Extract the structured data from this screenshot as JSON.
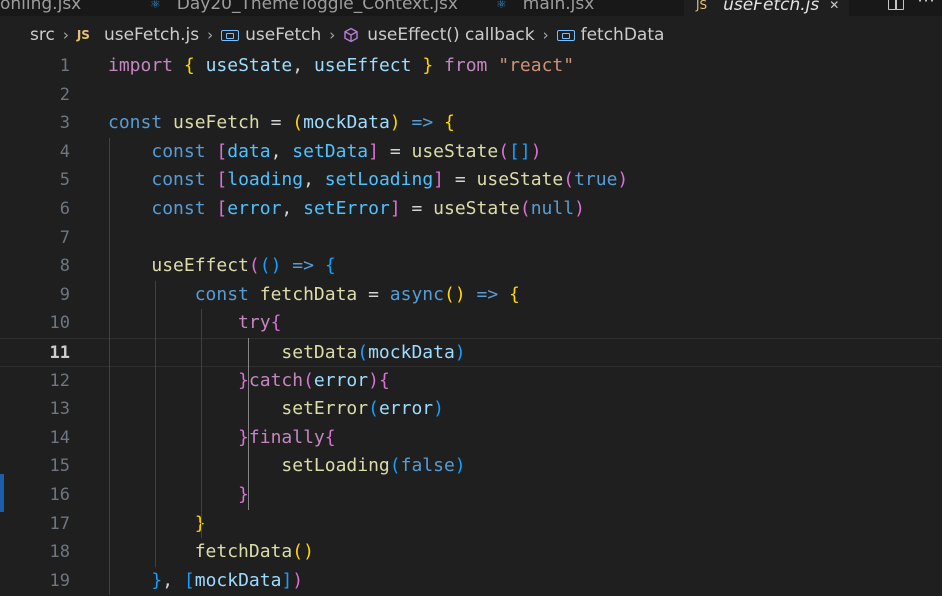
{
  "tabs": [
    {
      "label": "onling.jsx",
      "icon": "react-icon",
      "active": false
    },
    {
      "label": "Day20_ThemeToggle_Context.jsx",
      "icon": "react-icon",
      "active": false
    },
    {
      "label": "main.jsx",
      "icon": "react-icon",
      "active": false
    },
    {
      "label": "useFetch.js",
      "icon": "javascript-icon",
      "icon_text": "JS",
      "active": true,
      "close": "✕"
    }
  ],
  "breadcrumb": {
    "folder": "src",
    "file_icon_text": "JS",
    "file": "useFetch.js",
    "symbol1": "useFetch",
    "symbol2": "useEffect() callback",
    "symbol3": "fetchData",
    "separator": "›"
  },
  "editor": {
    "current_line": "11",
    "line_numbers": [
      "1",
      "2",
      "3",
      "4",
      "5",
      "6",
      "7",
      "8",
      "9",
      "10",
      "11",
      "12",
      "13",
      "14",
      "15",
      "16",
      "17",
      "18",
      "19"
    ],
    "lines": [
      [
        {
          "t": "import",
          "c": "k"
        },
        {
          "t": " ",
          "c": "p"
        },
        {
          "t": "{",
          "c": "b1"
        },
        {
          "t": " ",
          "c": "p"
        },
        {
          "t": "useState",
          "c": "v"
        },
        {
          "t": ", ",
          "c": "p"
        },
        {
          "t": "useEffect",
          "c": "v"
        },
        {
          "t": " ",
          "c": "p"
        },
        {
          "t": "}",
          "c": "b1"
        },
        {
          "t": " ",
          "c": "p"
        },
        {
          "t": "from",
          "c": "k"
        },
        {
          "t": " ",
          "c": "p"
        },
        {
          "t": "\"react\"",
          "c": "s"
        }
      ],
      [],
      [
        {
          "t": "const",
          "c": "st"
        },
        {
          "t": " ",
          "c": "p"
        },
        {
          "t": "useFetch",
          "c": "f"
        },
        {
          "t": " = ",
          "c": "p"
        },
        {
          "t": "(",
          "c": "b1"
        },
        {
          "t": "mockData",
          "c": "v"
        },
        {
          "t": ")",
          "c": "b1"
        },
        {
          "t": " ",
          "c": "p"
        },
        {
          "t": "=>",
          "c": "st"
        },
        {
          "t": " ",
          "c": "p"
        },
        {
          "t": "{",
          "c": "b1"
        }
      ],
      [
        {
          "t": "    ",
          "c": "p"
        },
        {
          "t": "const",
          "c": "st"
        },
        {
          "t": " ",
          "c": "p"
        },
        {
          "t": "[",
          "c": "b2"
        },
        {
          "t": "data",
          "c": "vc"
        },
        {
          "t": ", ",
          "c": "p"
        },
        {
          "t": "setData",
          "c": "vc"
        },
        {
          "t": "]",
          "c": "b2"
        },
        {
          "t": " = ",
          "c": "p"
        },
        {
          "t": "useState",
          "c": "f"
        },
        {
          "t": "(",
          "c": "b2"
        },
        {
          "t": "[]",
          "c": "b3"
        },
        {
          "t": ")",
          "c": "b2"
        }
      ],
      [
        {
          "t": "    ",
          "c": "p"
        },
        {
          "t": "const",
          "c": "st"
        },
        {
          "t": " ",
          "c": "p"
        },
        {
          "t": "[",
          "c": "b2"
        },
        {
          "t": "loading",
          "c": "vc"
        },
        {
          "t": ", ",
          "c": "p"
        },
        {
          "t": "setLoading",
          "c": "vc"
        },
        {
          "t": "]",
          "c": "b2"
        },
        {
          "t": " = ",
          "c": "p"
        },
        {
          "t": "useState",
          "c": "f"
        },
        {
          "t": "(",
          "c": "b2"
        },
        {
          "t": "true",
          "c": "st"
        },
        {
          "t": ")",
          "c": "b2"
        }
      ],
      [
        {
          "t": "    ",
          "c": "p"
        },
        {
          "t": "const",
          "c": "st"
        },
        {
          "t": " ",
          "c": "p"
        },
        {
          "t": "[",
          "c": "b2"
        },
        {
          "t": "error",
          "c": "vc"
        },
        {
          "t": ", ",
          "c": "p"
        },
        {
          "t": "setError",
          "c": "vc"
        },
        {
          "t": "]",
          "c": "b2"
        },
        {
          "t": " = ",
          "c": "p"
        },
        {
          "t": "useState",
          "c": "f"
        },
        {
          "t": "(",
          "c": "b2"
        },
        {
          "t": "null",
          "c": "st"
        },
        {
          "t": ")",
          "c": "b2"
        }
      ],
      [],
      [
        {
          "t": "    ",
          "c": "p"
        },
        {
          "t": "useEffect",
          "c": "f"
        },
        {
          "t": "(",
          "c": "b2"
        },
        {
          "t": "()",
          "c": "b3"
        },
        {
          "t": " ",
          "c": "p"
        },
        {
          "t": "=>",
          "c": "st"
        },
        {
          "t": " ",
          "c": "p"
        },
        {
          "t": "{",
          "c": "b3"
        }
      ],
      [
        {
          "t": "        ",
          "c": "p"
        },
        {
          "t": "const",
          "c": "st"
        },
        {
          "t": " ",
          "c": "p"
        },
        {
          "t": "fetchData",
          "c": "f"
        },
        {
          "t": " = ",
          "c": "p"
        },
        {
          "t": "async",
          "c": "st"
        },
        {
          "t": "()",
          "c": "b1"
        },
        {
          "t": " ",
          "c": "p"
        },
        {
          "t": "=>",
          "c": "st"
        },
        {
          "t": " ",
          "c": "p"
        },
        {
          "t": "{",
          "c": "b1"
        }
      ],
      [
        {
          "t": "            ",
          "c": "p"
        },
        {
          "t": "try",
          "c": "k"
        },
        {
          "t": "{",
          "c": "b2"
        }
      ],
      [
        {
          "t": "                ",
          "c": "p"
        },
        {
          "t": "setData",
          "c": "f"
        },
        {
          "t": "(",
          "c": "b3"
        },
        {
          "t": "mockData",
          "c": "v"
        },
        {
          "t": ")",
          "c": "b3"
        }
      ],
      [
        {
          "t": "            ",
          "c": "p"
        },
        {
          "t": "}",
          "c": "b2"
        },
        {
          "t": "catch",
          "c": "k"
        },
        {
          "t": "(",
          "c": "b2"
        },
        {
          "t": "error",
          "c": "v"
        },
        {
          "t": ")",
          "c": "b2"
        },
        {
          "t": "{",
          "c": "b2"
        }
      ],
      [
        {
          "t": "                ",
          "c": "p"
        },
        {
          "t": "setError",
          "c": "f"
        },
        {
          "t": "(",
          "c": "b3"
        },
        {
          "t": "error",
          "c": "v"
        },
        {
          "t": ")",
          "c": "b3"
        }
      ],
      [
        {
          "t": "            ",
          "c": "p"
        },
        {
          "t": "}",
          "c": "b2"
        },
        {
          "t": "finally",
          "c": "k"
        },
        {
          "t": "{",
          "c": "b2"
        }
      ],
      [
        {
          "t": "                ",
          "c": "p"
        },
        {
          "t": "setLoading",
          "c": "f"
        },
        {
          "t": "(",
          "c": "b3"
        },
        {
          "t": "false",
          "c": "st"
        },
        {
          "t": ")",
          "c": "b3"
        }
      ],
      [
        {
          "t": "            ",
          "c": "p"
        },
        {
          "t": "}",
          "c": "b2"
        }
      ],
      [
        {
          "t": "        ",
          "c": "p"
        },
        {
          "t": "}",
          "c": "b1"
        }
      ],
      [
        {
          "t": "        ",
          "c": "p"
        },
        {
          "t": "fetchData",
          "c": "f"
        },
        {
          "t": "()",
          "c": "b1"
        }
      ],
      [
        {
          "t": "    ",
          "c": "p"
        },
        {
          "t": "}",
          "c": "b3"
        },
        {
          "t": ", ",
          "c": "p"
        },
        {
          "t": "[",
          "c": "b3"
        },
        {
          "t": "mockData",
          "c": "v"
        },
        {
          "t": "]",
          "c": "b3"
        },
        {
          "t": ")",
          "c": "b2"
        }
      ]
    ]
  },
  "colors": {
    "background": "#1f1f1f",
    "keyword_control": "#c586c0",
    "keyword_storage": "#569cd6",
    "string": "#ce9178",
    "function": "#dcdcaa",
    "variable": "#9cdcfe",
    "bracket1": "#ffd700",
    "bracket2": "#da70d6",
    "bracket3": "#179fff"
  }
}
